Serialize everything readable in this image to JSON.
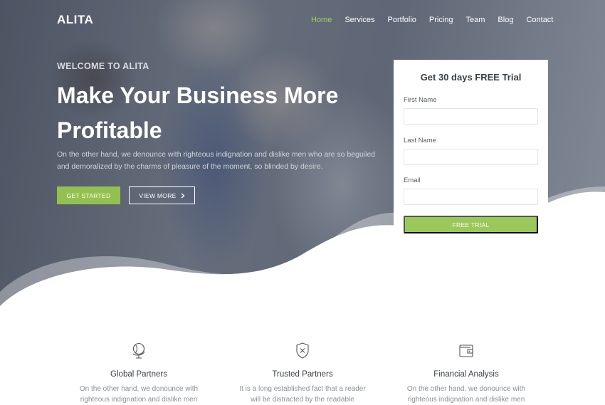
{
  "brand": {
    "logo": "ALITA"
  },
  "nav": {
    "items": [
      {
        "label": "Home",
        "active": true
      },
      {
        "label": "Services",
        "active": false
      },
      {
        "label": "Portfolio",
        "active": false
      },
      {
        "label": "Pricing",
        "active": false
      },
      {
        "label": "Team",
        "active": false
      },
      {
        "label": "Blog",
        "active": false
      },
      {
        "label": "Contact",
        "active": false
      }
    ]
  },
  "hero": {
    "welcome": "WELCOME TO ALITA",
    "headline_line1": "Make Your Business More",
    "headline_line2": "Profitable",
    "description": "On the other hand, we denounce with righteous indignation and dislike men who are so beguiled and demoralized by the charms of pleasure of the moment, so blinded by desire.",
    "primary_button": "GET STARTED",
    "secondary_button": "VIEW MORE",
    "secondary_icon": "chevron-right-icon"
  },
  "trial_form": {
    "title": "Get 30 days FREE Trial",
    "fields": [
      {
        "label": "First Name",
        "value": "",
        "placeholder": ""
      },
      {
        "label": "Last Name",
        "value": "",
        "placeholder": ""
      },
      {
        "label": "Email",
        "value": "",
        "placeholder": ""
      }
    ],
    "submit": "FREE TRIAL"
  },
  "features": [
    {
      "icon": "globe-icon",
      "title": "Global Partners",
      "desc_line1": "On the other hand, we donounce with",
      "desc_line2": "righteous indignation and dislike men"
    },
    {
      "icon": "shield-icon",
      "title": "Trusted Partners",
      "desc_line1": "It is a long established fact that a reader",
      "desc_line2": "will be distracted by the readable"
    },
    {
      "icon": "wallet-icon",
      "title": "Financial Analysis",
      "desc_line1": "On the other hand, we donounce with",
      "desc_line2": "righteous indignation and dislike men"
    }
  ],
  "colors": {
    "accent": "#92c14f",
    "nav_active": "#9fcf5c",
    "text_dark": "#3a3f47"
  }
}
